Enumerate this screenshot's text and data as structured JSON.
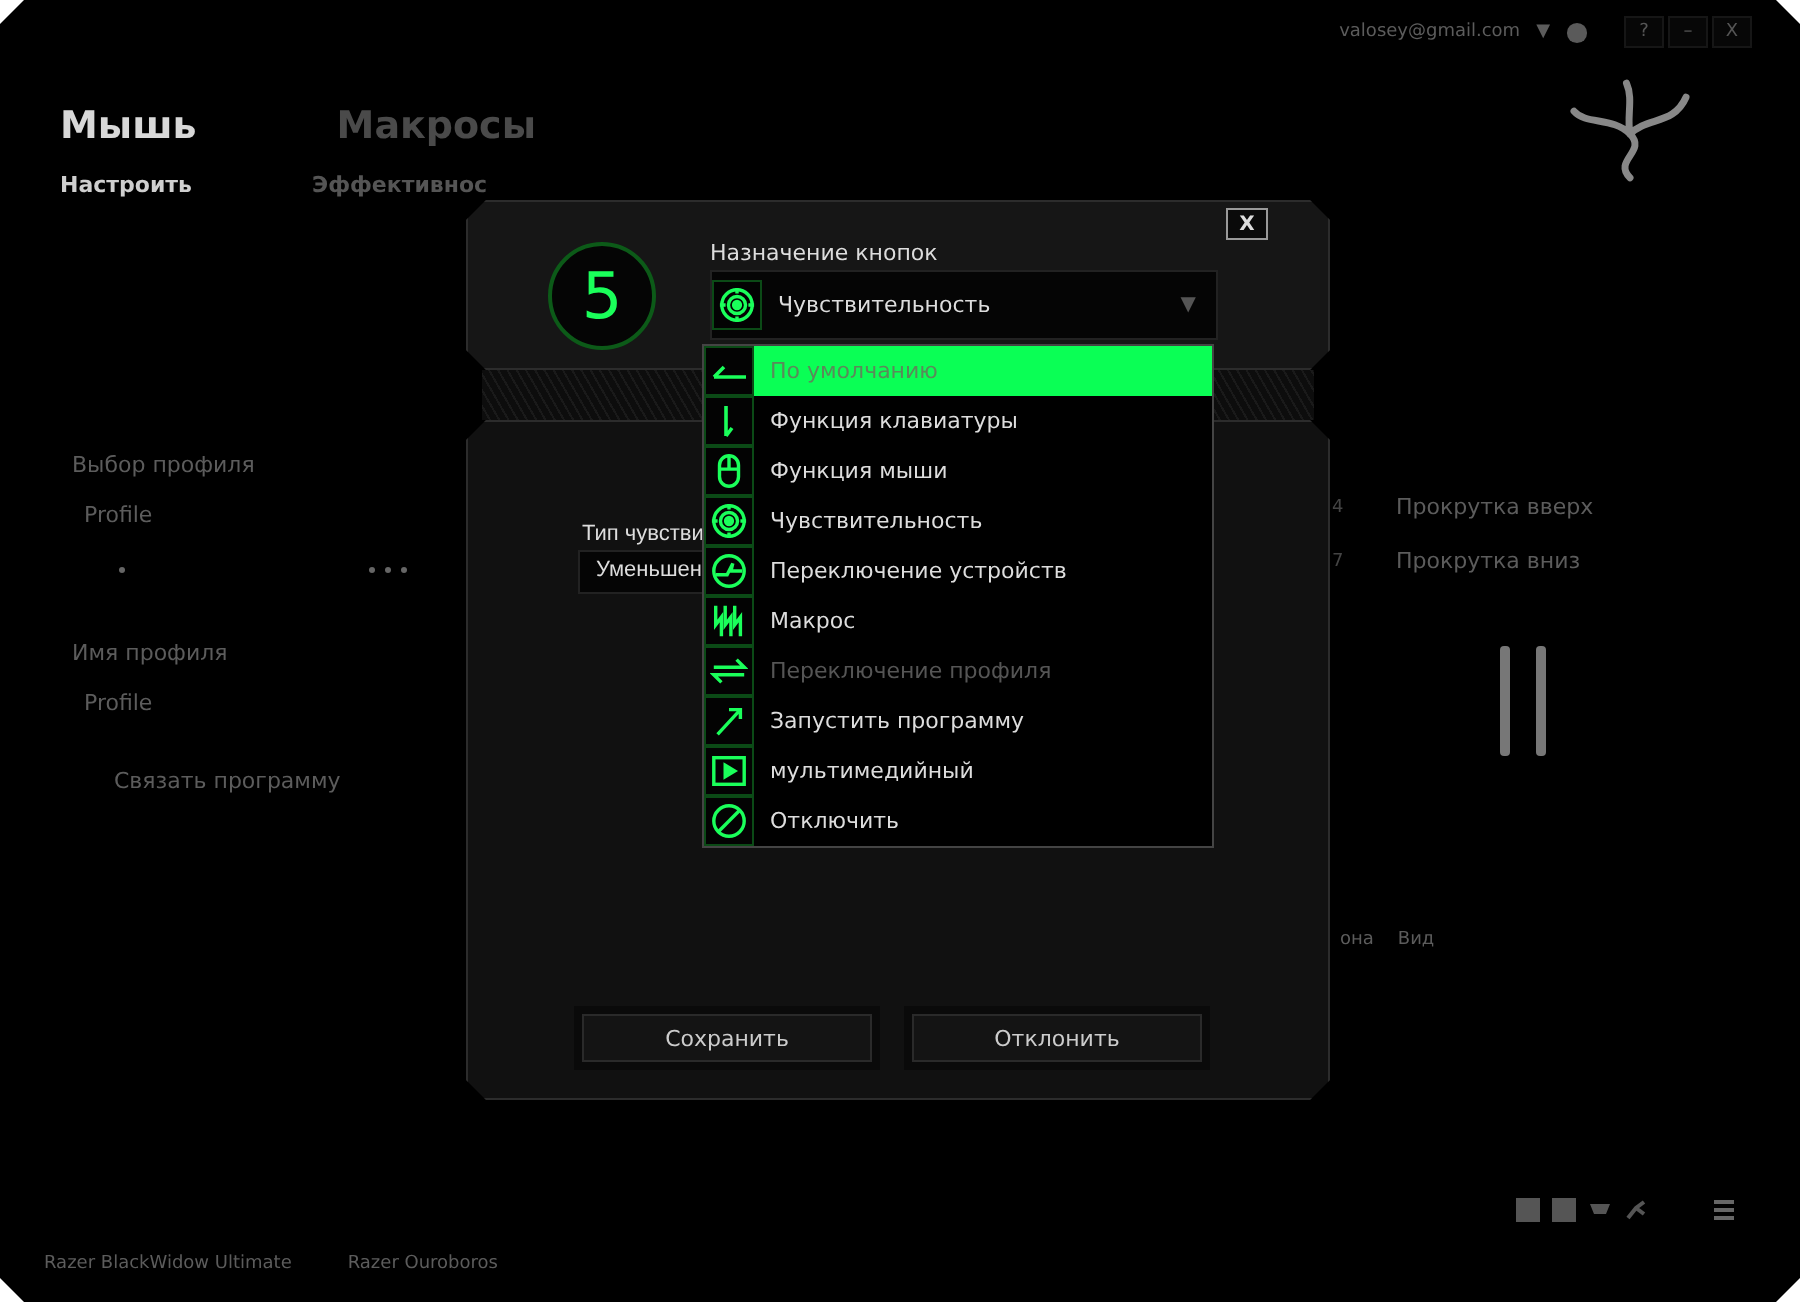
{
  "window": {
    "account": "valosey@gmail.com",
    "account_caret": "▼",
    "controls": [
      "?",
      "–",
      "X"
    ]
  },
  "tabs": [
    {
      "label": "Мышь",
      "selected": true
    },
    {
      "label": "Макросы",
      "selected": false
    }
  ],
  "subtabs": [
    {
      "label": "Настроить",
      "selected": true
    },
    {
      "label": "Эффективнос",
      "selected": false
    }
  ],
  "profile": {
    "select_label": "Выбор профиля",
    "select_value": "Profile",
    "name_label": "Имя профиля",
    "name_value": "Profile",
    "link_program": "Связать программу"
  },
  "button_list": [
    {
      "number": "4",
      "label": "Прокрутка вверх"
    },
    {
      "number": "7",
      "label": "Прокрутка вниз"
    }
  ],
  "view_labels": [
    "она",
    "Вид"
  ],
  "devices": [
    "Razer BlackWidow Ultimate",
    "Razer Ouroboros"
  ],
  "dialog": {
    "close": "X",
    "button_number": "5",
    "assign_label": "Назначение кнопок",
    "selected_function": "Чувствительность",
    "caret": "▼",
    "sensitivity_type_label": "Тип чувстви",
    "sensitivity_type_value": "Уменьшен",
    "save": "Сохранить",
    "cancel": "Отклонить",
    "options": [
      {
        "label": "По умолчанию",
        "kind": "default",
        "selected": true,
        "disabled": false
      },
      {
        "label": "Функция клавиатуры",
        "kind": "keyboard",
        "selected": false,
        "disabled": false
      },
      {
        "label": "Функция мыши",
        "kind": "mouse",
        "selected": false,
        "disabled": false
      },
      {
        "label": "Чувствительность",
        "kind": "sensitivity",
        "selected": false,
        "disabled": false
      },
      {
        "label": "Переключение устройств",
        "kind": "device",
        "selected": false,
        "disabled": false
      },
      {
        "label": "Макрос",
        "kind": "macro",
        "selected": false,
        "disabled": false
      },
      {
        "label": "Переключение профиля",
        "kind": "profile",
        "selected": false,
        "disabled": true
      },
      {
        "label": "Запустить программу",
        "kind": "launch",
        "selected": false,
        "disabled": false
      },
      {
        "label": "мультимедийный",
        "kind": "multimedia",
        "selected": false,
        "disabled": false
      },
      {
        "label": "Отключить",
        "kind": "disable",
        "selected": false,
        "disabled": false
      }
    ]
  }
}
